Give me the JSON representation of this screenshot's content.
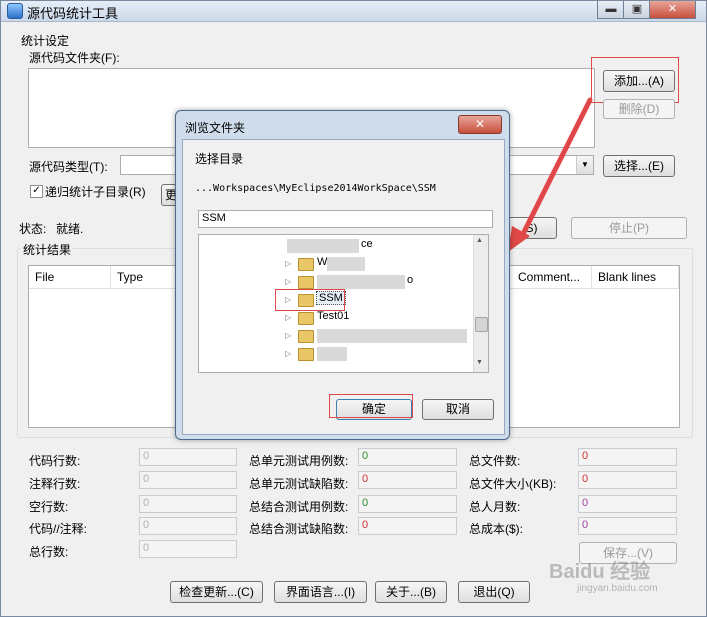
{
  "window": {
    "title": "源代码统计工具",
    "controls": {
      "minimize": "▬",
      "maximize": "▣",
      "close": "✕"
    }
  },
  "settings": {
    "group_label": "统计设定",
    "folder_label": "源代码文件夹(F):",
    "add_button": "添加...(A)",
    "delete_button": "删除(D)",
    "type_label": "源代码类型(T):",
    "type_value": "",
    "select_button": "选择...(E)",
    "recursive_label": "递归统计子目录(R)",
    "recursive_checked": "✓",
    "partial_button": "更"
  },
  "status": {
    "label": "状态:",
    "value": "就绪.",
    "start_button_partial": "S)",
    "stop_button": "停止(P)"
  },
  "results": {
    "group_label": "统计结果",
    "columns_left": [
      "File",
      "Type"
    ],
    "columns_right": [
      "Comment...",
      "Blank lines"
    ]
  },
  "stats": {
    "col1": [
      {
        "label": "代码行数:",
        "value": "0"
      },
      {
        "label": "注释行数:",
        "value": "0"
      },
      {
        "label": "空行数:",
        "value": "0"
      },
      {
        "label": "代码//注释:",
        "value": "0"
      },
      {
        "label": "总行数:",
        "value": "0"
      }
    ],
    "col2": [
      {
        "label": "总单元测试用例数:",
        "value": "0"
      },
      {
        "label": "总单元测试缺陷数:",
        "value": "0"
      },
      {
        "label": "总结合测试用例数:",
        "value": "0"
      },
      {
        "label": "总结合测试缺陷数:",
        "value": "0"
      }
    ],
    "col3": [
      {
        "label": "总文件数:",
        "value": "0"
      },
      {
        "label": "总文件大小(KB):",
        "value": "0"
      },
      {
        "label": "总人月数:",
        "value": "0"
      },
      {
        "label": "总成本($):",
        "value": "0"
      }
    ],
    "save_button": "保存...(V)"
  },
  "footer": {
    "check_update": "检查更新...(C)",
    "ui_language": "界面语言...(I)",
    "about": "关于...(B)",
    "exit": "退出(Q)"
  },
  "dialog": {
    "title": "浏览文件夹",
    "close": "✕",
    "prompt": "选择目录",
    "path": "...Workspaces\\MyEclipse2014WorkSpace\\SSM",
    "input_value": "SSM",
    "tree": {
      "partial_item": "ce",
      "partial_item_2": "o",
      "item_prefix": "W",
      "selected": "SSM",
      "next": "Test01"
    },
    "ok_button": "确定",
    "cancel_button": "取消"
  },
  "watermark": {
    "brand": "Baidu 经验",
    "url": "jingyan.baidu.com"
  },
  "colors": {
    "value_gray": "#b0b0b0",
    "value_green": "#2d8a2d",
    "value_red": "#d03030",
    "value_purple": "#a040a0",
    "highlight_red": "#e04848"
  }
}
